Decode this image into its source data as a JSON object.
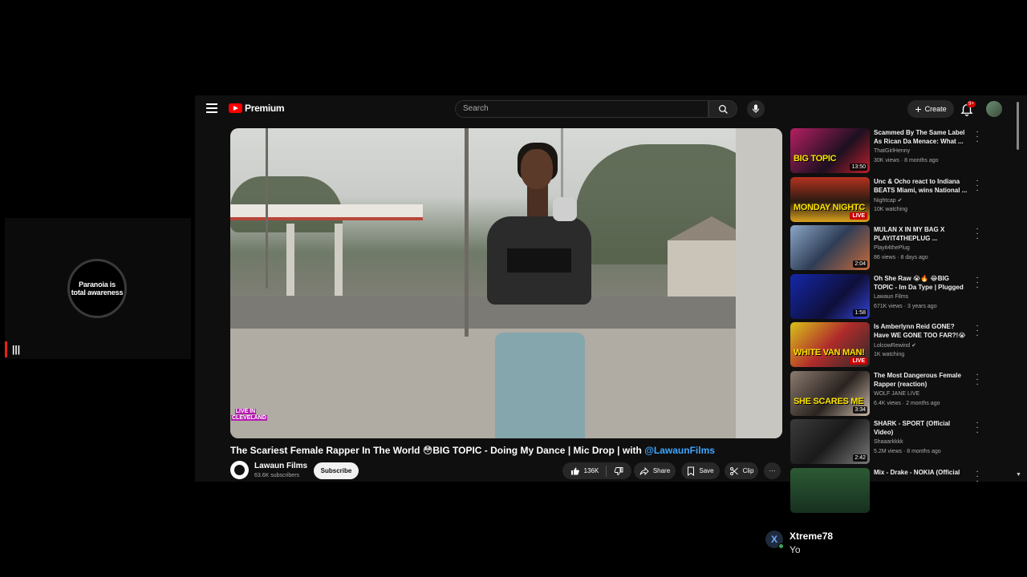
{
  "overlay": {
    "badge_line1": "Paranoia is",
    "badge_line2": "total awareness",
    "badge_small": "",
    "bars_icon": "bars-icon"
  },
  "header": {
    "logo_text": "Premium",
    "search_placeholder": "Search",
    "create_label": "Create",
    "notification_count": "9+"
  },
  "video": {
    "watermark_line1": "LIVE IN",
    "watermark_line2": "CLEVELAND",
    "title_prefix": "The Scariest Female Rapper In The World 😳BIG TOPIC - Doing My Dance | Mic Drop | with ",
    "title_link": "@LawaunFilms",
    "channel_name": "Lawaun Films",
    "channel_subs": "63.6K subscribers",
    "subscribe_label": "Subscribe",
    "like_count": "136K",
    "share_label": "Share",
    "save_label": "Save",
    "clip_label": "Clip"
  },
  "recommendations": [
    {
      "title": "Scammed By The  Same Label As Rican Da Menace: What ...",
      "channel": "ThatGirlHenny",
      "meta": "30K views · 8 months ago",
      "badge": "13:50",
      "live": false,
      "thumb_text": "BIG TOPIC"
    },
    {
      "title": "Unc & Ocho react to Indiana BEATS Miami, wins National ...",
      "channel": "Nightcap ✔",
      "meta": "10K watching",
      "badge": "LIVE",
      "live": true,
      "thumb_text": "MONDAY NIGHTC"
    },
    {
      "title": "MULAN X IN MY BAG X PLAYIT4THEPLUG ...",
      "channel": "Playit4thePlug",
      "meta": "86 views · 8 days ago",
      "badge": "2:04",
      "live": false,
      "thumb_text": ""
    },
    {
      "title": "Oh She Raw 😭🔥 😂BIG TOPIC - Im Da Type | Plugged In ...",
      "channel": "Lawaun Films",
      "meta": "671K views · 3 years ago",
      "badge": "1:58",
      "live": false,
      "thumb_text": ""
    },
    {
      "title": "Is Amberlynn Reid GONE? Have WE GONE TOO FAR?!😭🆘",
      "channel": "LolcowRewind ✔",
      "meta": "1K watching",
      "badge": "LIVE",
      "live": true,
      "thumb_text": "WHITE VAN MAN!"
    },
    {
      "title": "The Most Dangerous Female Rapper (reaction)",
      "channel": "WOLF JANE LIVE",
      "meta": "6.4K views · 2 months ago",
      "badge": "3:34",
      "live": false,
      "thumb_text": "SHE SCARES ME"
    },
    {
      "title": "SHARK - SPORT (Official Video)",
      "channel": "Shaaarkkkk",
      "meta": "5.2M views · 8 months ago",
      "badge": "2:42",
      "live": false,
      "thumb_text": ""
    },
    {
      "title": "Mix - Drake - NOKIA (Official",
      "channel": "",
      "meta": "",
      "badge": "",
      "live": false,
      "thumb_text": ""
    }
  ],
  "notification": {
    "name": "Xtreme78",
    "message": "Yo",
    "avatar_letter": "X"
  }
}
